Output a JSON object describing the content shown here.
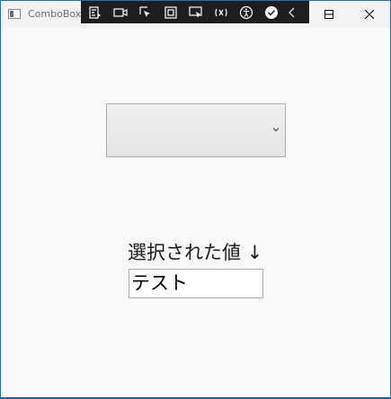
{
  "window": {
    "title": "ComboBox",
    "icon": "app-window-icon"
  },
  "debug_toolbar": {
    "buttons": [
      {
        "name": "go-to-live-visual-tree-icon"
      },
      {
        "name": "show-in-app-toolbar-icon"
      },
      {
        "name": "select-element-icon"
      },
      {
        "name": "display-layout-adorners-icon"
      },
      {
        "name": "track-focused-element-icon"
      },
      {
        "name": "binding-failures-icon"
      },
      {
        "name": "accessibility-icon"
      },
      {
        "name": "hot-reload-status-icon"
      },
      {
        "name": "collapse-toolbar-icon"
      }
    ]
  },
  "combobox": {
    "selected_text": "",
    "arrow_icon": "chevron-down-icon"
  },
  "label": {
    "text": "選択された値 ↓"
  },
  "selected_value": {
    "text": "テスト"
  }
}
